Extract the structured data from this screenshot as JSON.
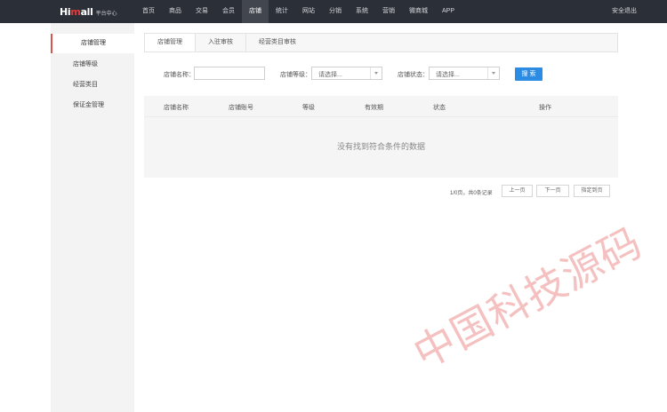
{
  "header": {
    "logo_brand_prefix": "Hi",
    "logo_brand_suffix": "all",
    "logo_subtitle": "平台中心",
    "nav": [
      "首页",
      "商品",
      "交易",
      "会员",
      "店铺",
      "统计",
      "网站",
      "分销",
      "系统",
      "营销",
      "微商城",
      "APP"
    ],
    "active_nav_index": 4,
    "logout_label": "安全退出"
  },
  "sidebar": {
    "items": [
      "店铺管理",
      "店铺等级",
      "经营类目",
      "保证金管理"
    ],
    "active_index": 0
  },
  "tabs": {
    "items": [
      "店铺管理",
      "入驻审核",
      "经营类目审核"
    ],
    "active_index": 0
  },
  "filter": {
    "shop_name_label": "店铺名称：",
    "shop_name_value": "",
    "shop_level_label": "店铺等级：",
    "shop_level_value": "请选择...",
    "shop_status_label": "店铺状态：",
    "shop_status_value": "请选择...",
    "search_button": "搜 索"
  },
  "table": {
    "columns": [
      "店铺名称",
      "店铺账号",
      "等级",
      "有效期",
      "状态",
      "操作"
    ],
    "rows": [],
    "empty_text": "没有找到符合条件的数据"
  },
  "pagination": {
    "info": "1/0页，共0条记录",
    "prev": "上一页",
    "next": "下一页",
    "jump": "指定到页"
  },
  "watermark": "中国科技源码",
  "colors": {
    "topbar": "#2b2f37",
    "accent_red": "#d9534f",
    "primary_blue": "#2c8ce4",
    "sidebar_bg": "#f3f3f3"
  }
}
